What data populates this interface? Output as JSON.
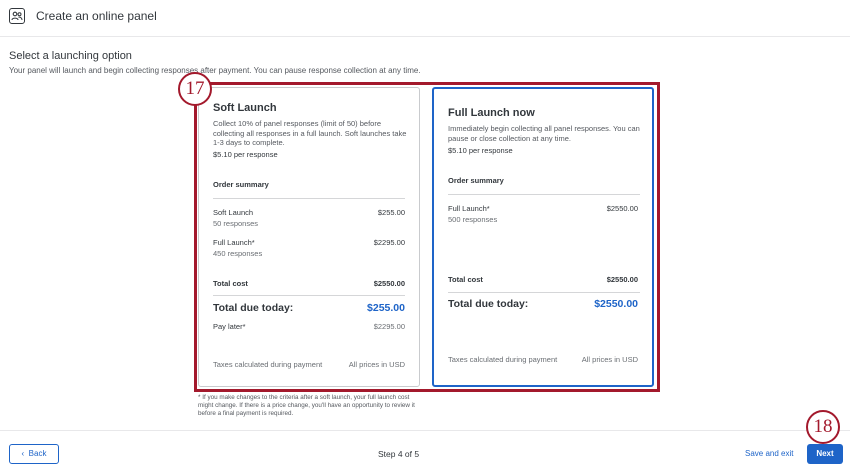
{
  "header": {
    "title": "Create an online panel",
    "icon": "users-panel-icon"
  },
  "section": {
    "title": "Select a launching option",
    "description": "Your panel will launch and begin collecting responses after payment. You can pause response collection at any time."
  },
  "annotations": {
    "badge_17": "17",
    "badge_18": "18"
  },
  "soft": {
    "title": "Soft Launch",
    "description": "Collect 10% of panel responses (limit of 50) before collecting all responses in a full launch. Soft launches take 1-3 days to complete.",
    "price": "$5.10 per response",
    "order_summary": "Order summary",
    "row1_label": "Soft Launch",
    "row1_sub": "50 responses",
    "row1_value": "$255.00",
    "row2_label": "Full Launch*",
    "row2_sub": "450 responses",
    "row2_value": "$2295.00",
    "total_label": "Total cost",
    "total_value": "$2550.00",
    "due_label": "Total due today:",
    "due_value": "$255.00",
    "pay_later_label": "Pay later*",
    "pay_later_value": "$2295.00",
    "taxes": "Taxes calculated during payment",
    "currency": "All prices in USD"
  },
  "full": {
    "title": "Full Launch now",
    "description": "Immediately begin collecting all panel responses. You can pause or close collection at any time.",
    "price": "$5.10 per response",
    "order_summary": "Order summary",
    "row1_label": "Full Launch*",
    "row1_sub": "500 responses",
    "row1_value": "$2550.00",
    "total_label": "Total cost",
    "total_value": "$2550.00",
    "due_label": "Total due today:",
    "due_value": "$2550.00",
    "taxes": "Taxes calculated during payment",
    "currency": "All prices in USD"
  },
  "disclaimer": "* If you make changes to the criteria after a soft launch, your full launch cost might change. If there is a price change, you'll have an opportunity to review it before a final payment is required.",
  "footer": {
    "back_label": "Back",
    "step_text": "Step 4 of 5",
    "save_exit_label": "Save and exit",
    "next_label": "Next"
  },
  "colors": {
    "accent": "#1e64c8",
    "annotation": "#a3192c"
  }
}
